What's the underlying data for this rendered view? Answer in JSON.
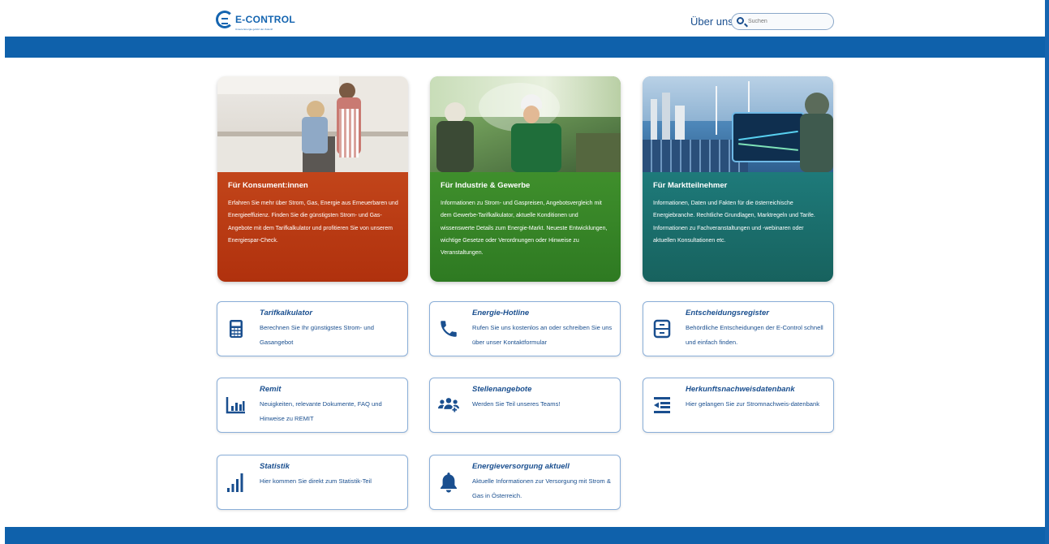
{
  "header": {
    "logo_text": "E-CONTROL",
    "logo_subtext": "Unsere Energie gehört der Zukunft",
    "about_link": "Über uns",
    "search_placeholder": "Suchen"
  },
  "big_cards": [
    {
      "title": "Für Konsument:innen",
      "text": "Erfahren Sie mehr über Strom, Gas, Energie aus Erneuerbaren und Energieeffizienz. Finden Sie die günstigsten Strom- und Gas-Angebote mit dem Tarifkalkulator und profitieren Sie von unserem Energiespar-Check.",
      "color": "#b93c14"
    },
    {
      "title": "Für Industrie & Gewerbe",
      "text": "Informationen zu Strom- und Gaspreisen, Angebotsvergleich mit dem Gewerbe-Tarifkalkulator, aktuelle Konditionen und wissenswerte Details zum Energie-Markt. Neueste Entwicklungen, wichtige Gesetze oder Verordnungen oder Hinweise zu Veranstaltungen.",
      "color": "#38852a"
    },
    {
      "title": "Für Marktteilnehmer",
      "text": "Informationen, Daten und Fakten für die österreichische Energiebranche. Rechtliche Grundlagen, Marktregeln und Tarife. Informationen zu Fachveranstaltungen und -webinaren oder aktuellen Konsultationen etc.",
      "color": "#1b6f6d"
    }
  ],
  "small_cards": [
    {
      "title": "Tarifkalkulator",
      "text": "Berechnen Sie Ihr günstigstes Strom- und Gasangebot",
      "icon": "calculator-icon"
    },
    {
      "title": "Energie-Hotline",
      "text": "Rufen Sie uns kostenlos an oder schreiben Sie uns über unser Kontaktformular",
      "icon": "phone-icon"
    },
    {
      "title": "Entscheidungsregister",
      "text": "Behördliche Entscheidungen der E-Control schnell und einfach finden.",
      "icon": "register-icon"
    },
    {
      "title": "Remit",
      "text": "Neuigkeiten, relevante Dokumente, FAQ und Hinweise zu REMIT",
      "icon": "bar-chart-icon"
    },
    {
      "title": "Stellenangebote",
      "text": "Werden Sie Teil unseres Teams!",
      "icon": "team-add-icon"
    },
    {
      "title": "Herkunftsnachweisdatenbank",
      "text": "Hier gelangen Sie zur Stromnachweis-datenbank",
      "icon": "list-indent-icon"
    },
    {
      "title": "Statistik",
      "text": "Hier kommen Sie direkt zum Statistik-Teil",
      "icon": "signal-bars-icon"
    },
    {
      "title": "Energieversorgung aktuell",
      "text": "Aktuelle Informationen zur Versorgung mit Strom & Gas in Österreich.",
      "icon": "bell-icon"
    }
  ],
  "colors": {
    "brand_blue": "#0f61ab",
    "text_blue": "#1a4f8f",
    "card_border": "#8aaed8"
  }
}
